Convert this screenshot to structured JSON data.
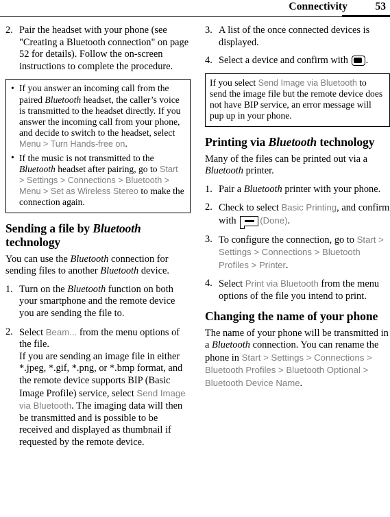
{
  "header": {
    "title": "Connectivity",
    "page_number": "53"
  },
  "left_column": {
    "step2": {
      "number": "2.",
      "text_a": "Pair the headset with your phone (see \"Creating a Bluetooth connection\" on page 52 for details). Follow the on-screen instructions to complete the procedure."
    },
    "note_box": {
      "bullets": [
        {
          "marker": "•",
          "seg1": "If you answer an incoming call from the paired ",
          "bt1": "Bluetooth",
          "seg2": " headset, the caller’s voice is transmitted to the headset directly. If you answer the incoming call from your phone, and decide to switch to the headset, select ",
          "ui1": "Menu > Turn Hands-free on",
          "seg3": "."
        },
        {
          "marker": "•",
          "seg1": "If the music is not transmitted to the ",
          "bt1": "Bluetooth",
          "seg2": " headset after pairing, go to ",
          "ui1": "Start > Settings > Connections > Bluetooth > Menu > Set as Wireless Stereo",
          "seg3": " to make the connection again."
        }
      ]
    },
    "heading_sending": {
      "seg1": "Sending a file by ",
      "bt1": "Bluetooth",
      "seg2": " technology"
    },
    "intro": {
      "seg1": "You can use the ",
      "bt1": "Bluetooth",
      "seg2": " connection for sending files to another ",
      "bt2": "Bluetooth",
      "seg3": " device."
    },
    "step1": {
      "number": "1.",
      "seg1": "Turn on the ",
      "bt1": "Bluetooth",
      "seg2": " function on both your smartphone and the remote device you are sending the file to."
    },
    "step2b": {
      "number": "2.",
      "seg1": "Select ",
      "ui1": "Beam...",
      "seg2": " from the menu options of the file.",
      "sub_seg1": "If you are sending an image file in either *.jpeg, *.gif, *.png, or *.bmp format, and the remote device supports BIP (Basic Image Profile) service, select ",
      "sub_ui1": "Send Image via Bluetooth",
      "sub_seg2": ". The imaging data will then be transmitted and is possible to be received and displayed as thumbnail if requested by the remote device."
    }
  },
  "right_column": {
    "step3": {
      "number": "3.",
      "text": "A list of the once connected devices is displayed."
    },
    "step4": {
      "number": "4.",
      "seg1": "Select a device and confirm with ",
      "icon": "ok-key-icon",
      "seg2": "."
    },
    "note_box": {
      "seg1": "If you select ",
      "ui1": "Send Image via Bluetooth",
      "seg2": " to send the image file but the remote device does not have BIP service, an error message will pup up in your phone."
    },
    "heading_printing": {
      "seg1": "Printing via ",
      "bt1": "Bluetooth",
      "seg2": " technology"
    },
    "intro": {
      "seg1": "Many of the files can be printed out via a ",
      "bt1": "Bluetooth",
      "seg2": " printer."
    },
    "step1": {
      "number": "1.",
      "seg1": "Pair a ",
      "bt1": "Bluetooth",
      "seg2": " printer with your phone."
    },
    "step2": {
      "number": "2.",
      "seg1": "Check to select ",
      "ui1": "Basic Printing",
      "seg2": ", and confirm with ",
      "icon": "softkey-icon",
      "ui2": "(Done)",
      "seg3": "."
    },
    "step3b": {
      "number": "3.",
      "seg1": "To configure the connection, go to ",
      "ui1": "Start > Settings > Connections > Bluetooth Profiles > Printer",
      "seg2": "."
    },
    "step4b": {
      "number": "4.",
      "seg1": "Select ",
      "ui1": "Print via Bluetooth",
      "seg2": " from the menu options of the file you intend to print."
    },
    "heading_changing": {
      "text": "Changing the name of your phone"
    },
    "outro": {
      "seg1": "The name of your phone will be transmitted in a ",
      "bt1": "Bluetooth",
      "seg2": " connection. You can rename the phone in ",
      "ui1": "Start > Settings > Connections > Bluetooth Profiles > Bluetooth Optional > Bluetooth Device Name",
      "seg3": "."
    }
  }
}
